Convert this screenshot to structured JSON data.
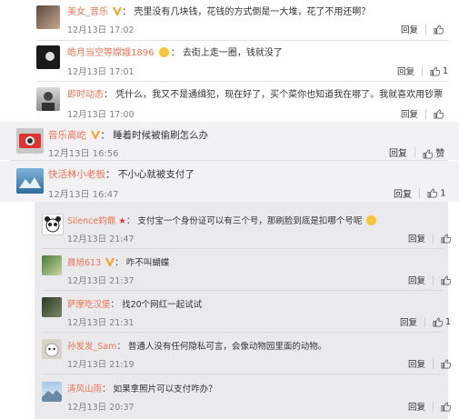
{
  "comments": [
    {
      "user": "美女_音乐",
      "text": "壳里没有几块钱，花钱的方式倒是一大堆，花了不用还啊？",
      "time": "12月13日 17:02",
      "reply": "回复",
      "likes": ""
    },
    {
      "user": "皓月当空等嫦娥1896",
      "text": "去街上走一圈，钱就没了",
      "time": "12月13日 17:01",
      "reply": "回复",
      "likes": "1"
    },
    {
      "user": "即时动态",
      "text": "凭什么，我又不是通缉犯，现在好了，买个菜你也知道我在哪了。我就喜欢用钞票",
      "time": "12月13日 17:00",
      "reply": "回复",
      "likes": ""
    },
    {
      "user": "音乐高屹",
      "text": "睡着时候被偷刷怎么办",
      "time": "12月13日 16:56",
      "reply": "回复",
      "likes": "赞"
    },
    {
      "user": "快活林小老板",
      "text": "不小心就被支付了",
      "time": "12月13日 16:47",
      "reply": "回复",
      "likes": "1"
    },
    {
      "user": "Silence鈞鼎",
      "text": "支付宝一个身份证可以有三个号，那刷脸到底是扣哪个号呢",
      "time": "12月13日 21:47",
      "reply": "回复",
      "likes": ""
    },
    {
      "user": "晨旭613",
      "text": "咋不叫蝴蝶",
      "time": "12月13日 21:37",
      "reply": "回复",
      "likes": ""
    },
    {
      "user": "萨摩吃汉堡",
      "text": "找20个网红一起试试",
      "time": "12月13日 21:31",
      "reply": "回复",
      "likes": "1"
    },
    {
      "user": "孙发发_Sam",
      "text": "普通人没有任何隐私可言，会像动物园里面的动物。",
      "time": "12月13日 21:19",
      "reply": "回复",
      "likes": ""
    },
    {
      "user": "清风山雨",
      "text": "如果拿照片可以支付咋办？",
      "time": "12月13日 20:37",
      "reply": "回复",
      "likes": ""
    }
  ],
  "colors": {
    "username": "#eb7350",
    "vbadge": "#f7a21b",
    "red_badge": "#e4393c"
  }
}
